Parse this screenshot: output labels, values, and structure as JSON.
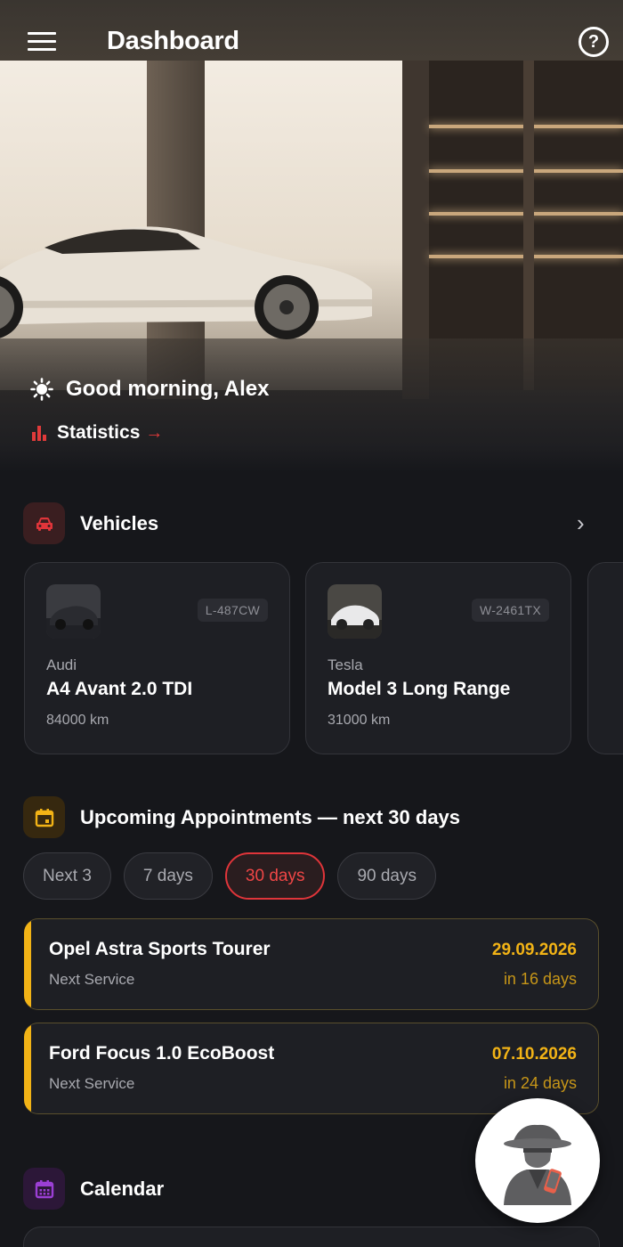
{
  "header": {
    "title": "Dashboard"
  },
  "hero": {
    "greeting": "Good morning, Alex",
    "stats_label": "Statistics"
  },
  "vehicles": {
    "title": "Vehicles",
    "items": [
      {
        "make": "Audi",
        "model": "A4 Avant 2.0 TDI",
        "plate": "L-487CW",
        "km": "84000 km"
      },
      {
        "make": "Tesla",
        "model": "Model 3 Long Range",
        "plate": "W-2461TX",
        "km": "31000 km"
      }
    ]
  },
  "appointments": {
    "title": "Upcoming Appointments — next 30 days",
    "filters": [
      "Next 3",
      "7 days",
      "30 days",
      "90 days"
    ],
    "active_filter": "30 days",
    "items": [
      {
        "vehicle": "Opel Astra Sports Tourer",
        "type": "Next Service",
        "date": "29.09.2026",
        "relative": "in 16 days"
      },
      {
        "vehicle": "Ford Focus 1.0 EcoBoost",
        "type": "Next Service",
        "date": "07.10.2026",
        "relative": "in 24 days"
      }
    ]
  },
  "calendar": {
    "title": "Calendar"
  },
  "colors": {
    "accent_red": "#e0353a",
    "accent_amber": "#f2b316",
    "accent_purple": "#9b3fd4",
    "background": "#16171b"
  }
}
